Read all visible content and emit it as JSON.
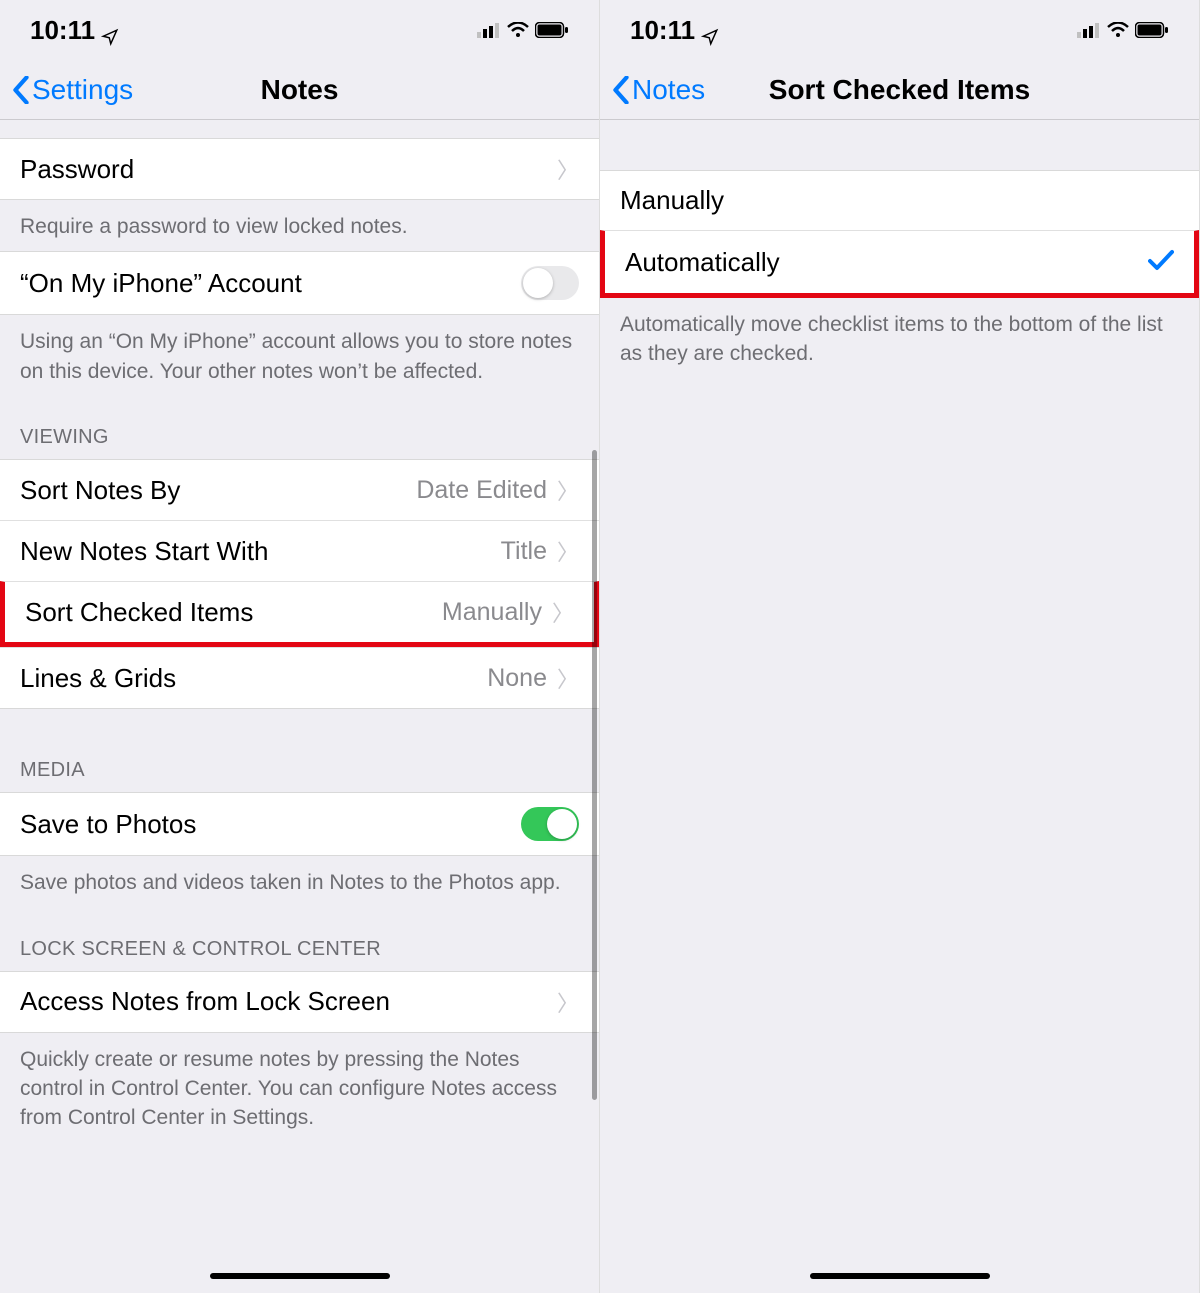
{
  "status": {
    "time": "10:11"
  },
  "left": {
    "nav": {
      "back": "Settings",
      "title": "Notes"
    },
    "password": {
      "label": "Password",
      "footer": "Require a password to view locked notes."
    },
    "onmyiphone": {
      "label": "“On My iPhone” Account",
      "footer": "Using an “On My iPhone” account allows you to store notes on this device. Your other notes won’t be affected."
    },
    "viewing": {
      "header": "VIEWING",
      "sort_notes_label": "Sort Notes By",
      "sort_notes_value": "Date Edited",
      "new_notes_label": "New Notes Start With",
      "new_notes_value": "Title",
      "sort_checked_label": "Sort Checked Items",
      "sort_checked_value": "Manually",
      "lines_label": "Lines & Grids",
      "lines_value": "None"
    },
    "media": {
      "header": "MEDIA",
      "save_photos_label": "Save to Photos",
      "footer": "Save photos and videos taken in Notes to the Photos app."
    },
    "lockscreen": {
      "header": "LOCK SCREEN & CONTROL CENTER",
      "access_label": "Access Notes from Lock Screen",
      "footer": "Quickly create or resume notes by pressing the Notes control in Control Center. You can configure Notes access from Control Center in Settings."
    }
  },
  "right": {
    "nav": {
      "back": "Notes",
      "title": "Sort Checked Items"
    },
    "options": {
      "manually": "Manually",
      "automatically": "Automatically"
    },
    "footer": "Automatically move checklist items to the bottom of the list as they are checked."
  }
}
